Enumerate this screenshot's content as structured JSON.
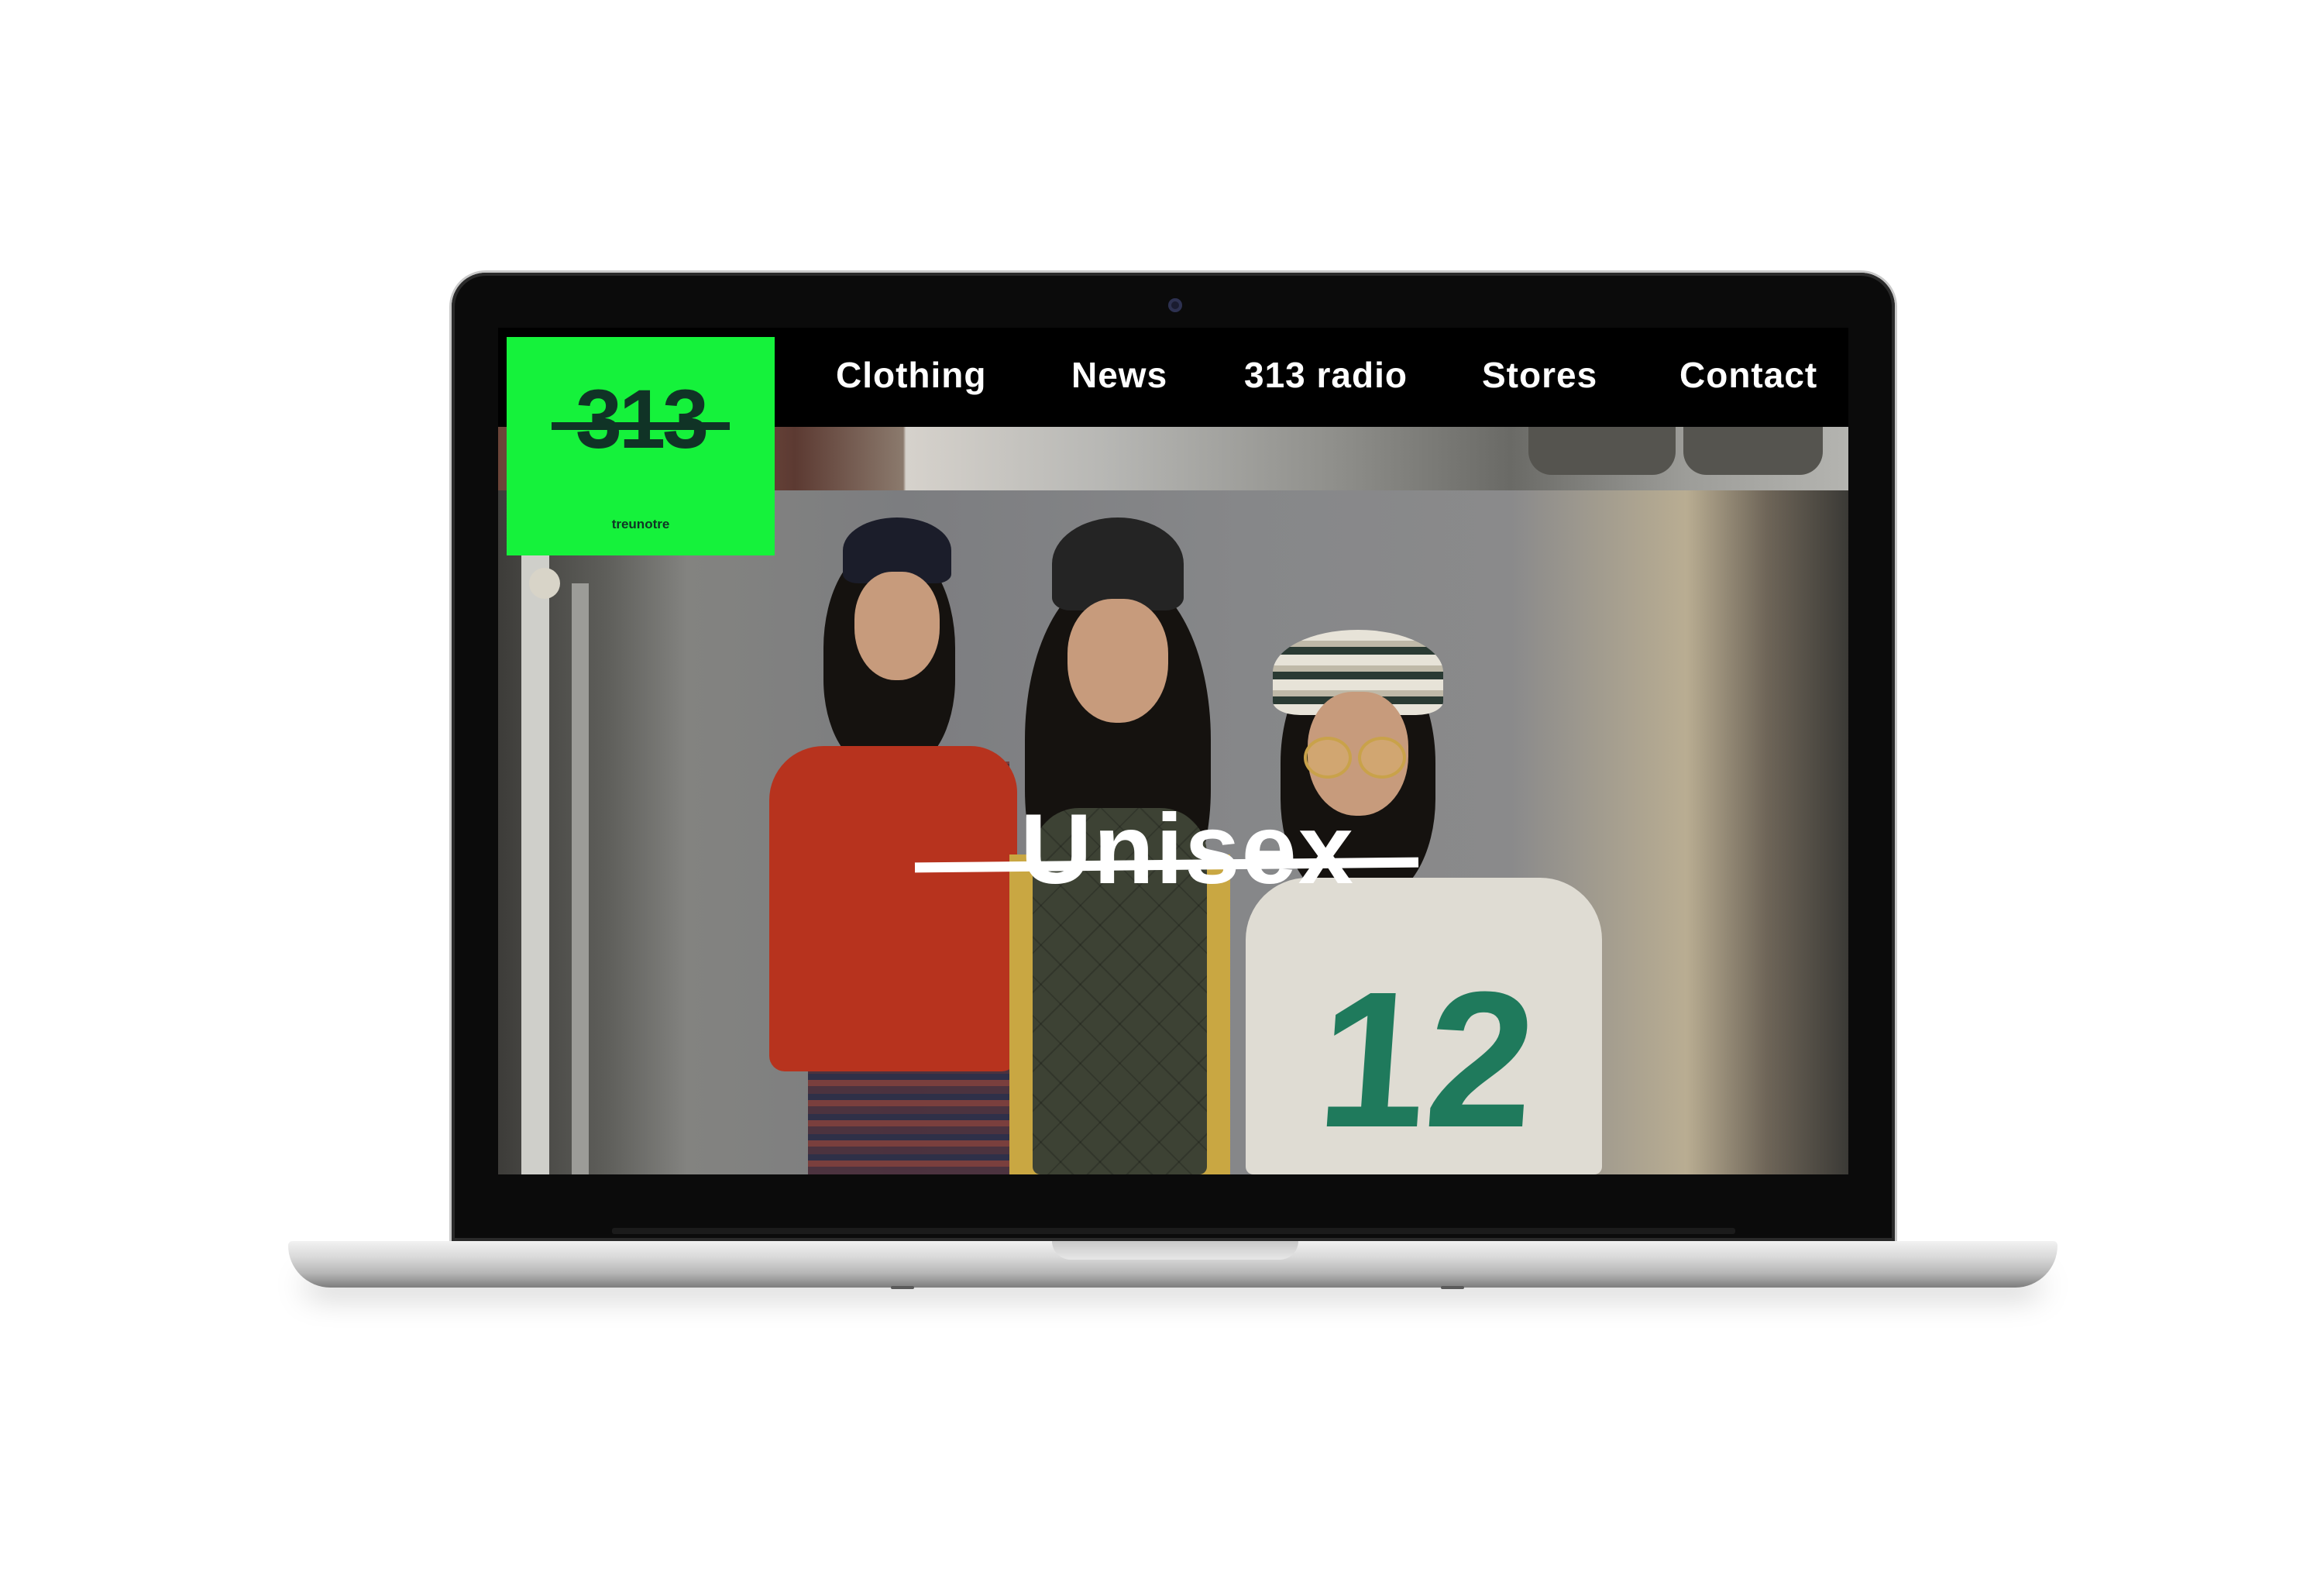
{
  "nav": {
    "items": [
      {
        "label": "Clothing"
      },
      {
        "label": "News"
      },
      {
        "label": "313 radio"
      },
      {
        "label": "Stores"
      },
      {
        "label": "Contact"
      }
    ]
  },
  "logo": {
    "number": "313",
    "subtitle": "treunotre",
    "background": "#15f23b"
  },
  "hero": {
    "title": "Unisex"
  },
  "jersey": {
    "number": "12"
  },
  "colors": {
    "accent_green": "#15f23b",
    "nav_background": "#000000",
    "text_white": "#ffffff"
  }
}
